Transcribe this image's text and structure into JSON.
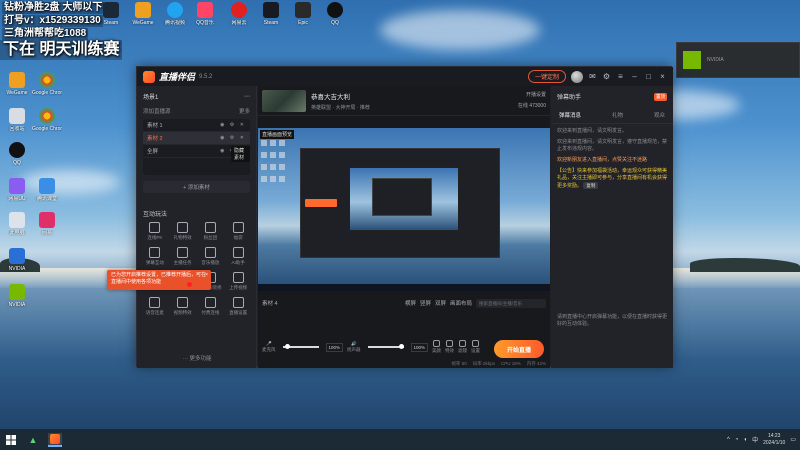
{
  "overlay": {
    "line1": "钻粉净胜2盘 大师以下",
    "line2": "打号v：x1529339130",
    "line3": "三角洲帮帮吃1088",
    "line4": "下在 明天训练赛"
  },
  "desktop": {
    "top_icons": [
      "Steam",
      "WeGame",
      "腾讯视频",
      "QQ音乐",
      "网易云",
      "Steam",
      "Epic",
      "QQ"
    ],
    "left_icons": [
      "WeGame",
      "Google Chrome",
      "回收站",
      "QQ",
      "Google Chrome",
      "网易UU",
      "腾讯课堂",
      "此电脑",
      "NVIDIA",
      "网易"
    ]
  },
  "app": {
    "name": "直播伴侣",
    "version": "9.5.2",
    "customize_label": "一键定制",
    "scene_header": "场景1",
    "source_header": "添加直播源",
    "source_header_right": "更多",
    "sources": [
      "素材 1",
      "素材 2",
      "全屏"
    ],
    "tooltip": "隐藏素材",
    "add_source_label": "+ 添加素材",
    "tools_header": "互动玩法",
    "tools": [
      "连线PK",
      "礼物特效",
      "粉丝团",
      "福袋",
      "弹幕互动",
      "主播任务",
      "音乐播放",
      "AI助手",
      "直播回放",
      "数据中心",
      "直播间装修",
      "上传视频",
      "语音连麦",
      "视频特效",
      "付费连线",
      "直播设置"
    ],
    "more_label": "··· 更多功能",
    "stream_title": "恭喜大吉大利",
    "stream_meta": "英雄联盟 · 大神开局 · 推荐",
    "stream_right_1": "开播设置",
    "stream_right_2": "在线 473000",
    "preview_label": "直播画面预览",
    "ctrl_left": "素材 4",
    "ctrl_mid": [
      "横屏",
      "竖屏",
      "双屏"
    ],
    "ctrl_dropdown": "画面布局",
    "search_placeholder": "搜索直播间/主播/音乐",
    "mic_label": "麦克风",
    "mic_volume": "100%",
    "speaker_label": "扬声器",
    "speaker_volume": "100%",
    "audio_icons": [
      "美颜",
      "特效",
      "滤镜",
      "设置"
    ],
    "live_button": "开始直播",
    "status_items": [
      "帧率 60",
      "码率 0kbps",
      "CPU 18%",
      "内存 42%"
    ],
    "right_title": "弹幕助手",
    "right_pin": "置顶",
    "right_tabs": [
      "弹幕消息",
      "礼物",
      "观众"
    ],
    "messages": [
      {
        "text": "欢迎来到直播间，请文明发言。",
        "style": "normal"
      },
      {
        "text": "欢迎来到直播间，请文明发言，遵守直播规范，禁止发布违规内容。",
        "style": "normal"
      },
      {
        "text": "欢迎新朋友进入直播间，点赞关注不迷路",
        "style": "hl"
      },
      {
        "text": "【公告】快来参加福袋活动，幸运观众可获得精美礼品，关注主播即可参与，分享直播间有机会获得更多奖励。",
        "style": "hl2"
      }
    ],
    "msg_tag": "复制",
    "right_footer": "请到直播中心开启弹幕功能，以便在直播时获得更好的互动体验。"
  },
  "toast": {
    "text": "已为您开启推荐设置，已推荐开播后，可在直播间中使用各项功能",
    "close": "×"
  },
  "taskbar": {
    "time": "14:23",
    "date": "2024/1/10",
    "tray_text": "中"
  },
  "colors": {
    "accent": "#ff5a2a",
    "live_button_start": "#ff9a2a",
    "window_bg": "#1f2026"
  }
}
